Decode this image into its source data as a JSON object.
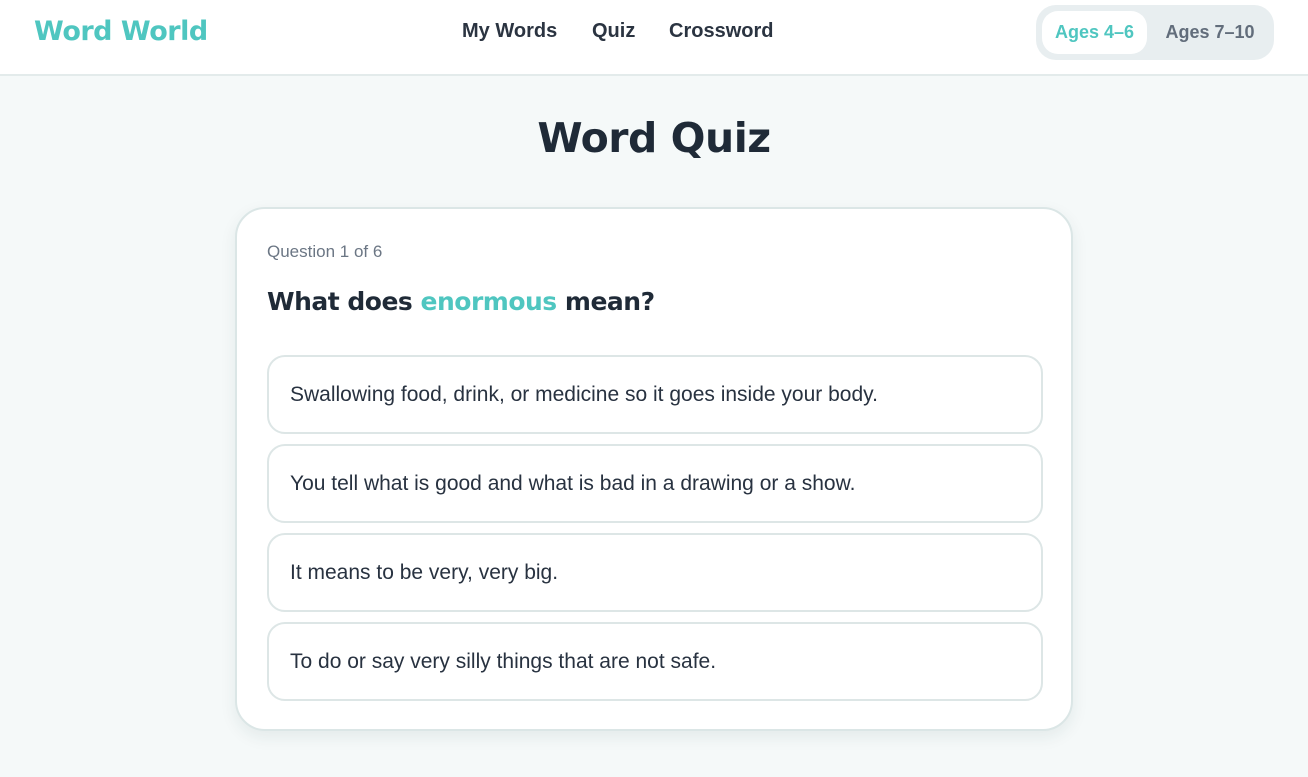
{
  "header": {
    "logo": "Word World",
    "nav": [
      {
        "label": "My Words"
      },
      {
        "label": "Quiz"
      },
      {
        "label": "Crossword"
      }
    ],
    "age_toggle": {
      "options": [
        "Ages 4–6",
        "Ages 7–10"
      ],
      "selected": "Ages 4–6"
    }
  },
  "main": {
    "title": "Word Quiz",
    "quiz": {
      "counter": "Question 1 of 6",
      "question_prefix": "What does ",
      "question_word": "enormous",
      "question_suffix": " mean?",
      "options": [
        "Swallowing food, drink, or medicine so it goes inside your body.",
        "You tell what is good and what is bad in a drawing or a show.",
        "It means to be very, very big.",
        "To do or say very silly things that are not safe."
      ]
    }
  },
  "colors": {
    "accent": "#4fc6c0",
    "text": "#1f2a37",
    "background": "#f5f9f9"
  }
}
